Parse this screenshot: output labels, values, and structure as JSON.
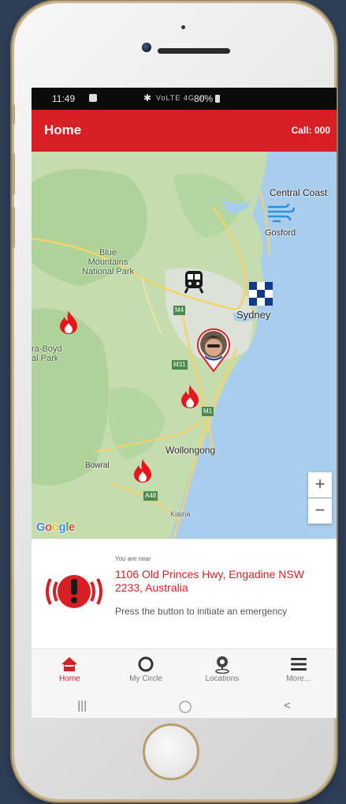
{
  "status_bar": {
    "time": "11:49",
    "network": "VoLTE 4G .ıl",
    "battery": "80%"
  },
  "app_bar": {
    "title": "Home",
    "call_label": "Call: 000"
  },
  "map": {
    "labels": {
      "central_coast": "Central Coast",
      "gosford": "Gosford",
      "blue_mountains_1": "Blue",
      "blue_mountains_2": "Mountains",
      "blue_mountains_3": "National Park",
      "sydney": "Sydney",
      "boyd_1": "ra-Boyd",
      "boyd_2": "al Park",
      "wollongong": "Wollongong",
      "bowral": "Bowral",
      "kiama": "Kiama",
      "m4": "M4",
      "m31": "M31",
      "m1": "M1",
      "a48": "A48"
    },
    "zoom_in": "+",
    "zoom_out": "−",
    "attribution": "Google",
    "colors": {
      "water": "#a9cdec",
      "land": "#c4dcae",
      "forest": "#a9ce94",
      "urban": "#dfe3dc",
      "road": "#f3d36a"
    },
    "markers": [
      "fire-icon",
      "fire-icon",
      "fire-icon",
      "train-icon",
      "flood-icon",
      "wind-icon",
      "user-location-pin"
    ]
  },
  "alert_card": {
    "near_label": "You are near",
    "address": "1106 Old Princes Hwy, Engadine NSW 2233, Australia",
    "hint": "Press the button to initiate an emergency"
  },
  "bottom_nav": {
    "items": [
      {
        "label": "Home",
        "icon": "home-icon",
        "active": true
      },
      {
        "label": "My Circle",
        "icon": "circle-icon",
        "active": false
      },
      {
        "label": "Locations",
        "icon": "location-icon",
        "active": false
      },
      {
        "label": "More...",
        "icon": "menu-icon",
        "active": false
      }
    ]
  },
  "system_nav": {
    "recents": "|||",
    "home": "◯",
    "back": "<"
  },
  "colors": {
    "brand_red": "#d81f26",
    "background": "#2e3f58",
    "phone_gold": "#c9b58b"
  }
}
